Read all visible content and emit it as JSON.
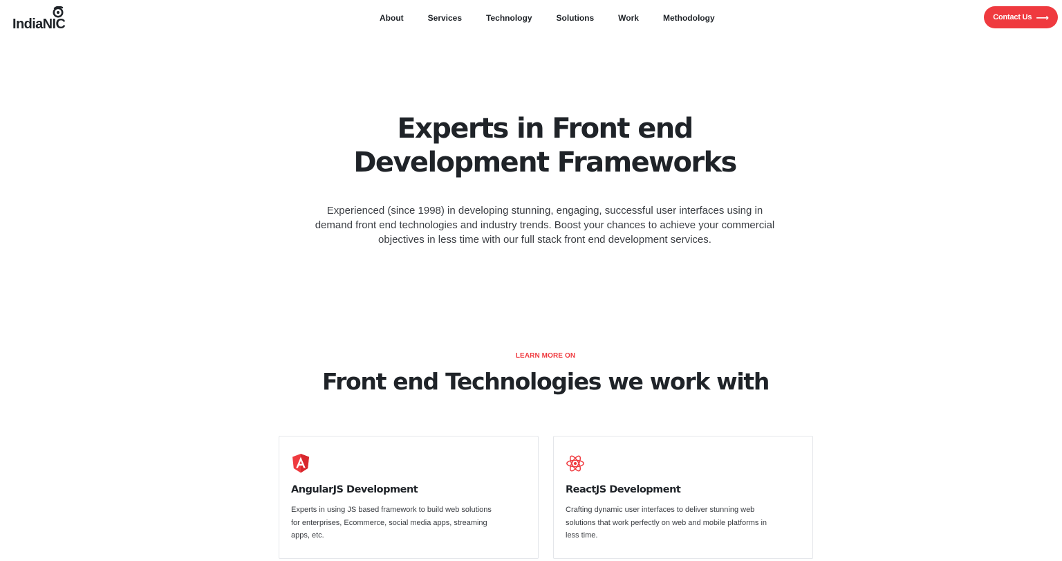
{
  "header": {
    "logo_text": "IndiaNIC",
    "nav": [
      {
        "label": "About"
      },
      {
        "label": "Services"
      },
      {
        "label": "Technology"
      },
      {
        "label": "Solutions"
      },
      {
        "label": "Work"
      },
      {
        "label": "Methodology"
      }
    ],
    "contact_label": "Contact Us",
    "contact_icon": "arrow-right-icon"
  },
  "hero": {
    "title_line1": "Experts in Front end",
    "title_line2": "Development Frameworks",
    "description": "Experienced (since 1998) in developing stunning, engaging, successful user interfaces using in demand front end technologies and industry trends. Boost your chances to achieve your commercial objectives in less time with our full stack front end development services."
  },
  "technologies": {
    "eyebrow": "LEARN MORE ON",
    "title": "Front end Technologies we work with",
    "cards": [
      {
        "icon": "angular-icon",
        "title": "AngularJS Development",
        "description": "Experts in using JS based framework to build web solutions for enterprises, Ecommerce, social media apps, streaming apps, etc."
      },
      {
        "icon": "react-icon",
        "title": "ReactJS Development",
        "description": "Crafting dynamic user interfaces to deliver stunning web solutions that work perfectly on web and mobile platforms in less time."
      }
    ]
  },
  "colors": {
    "accent": "#ef3a3f",
    "text": "#1f2328",
    "body_text": "#3a3d42",
    "card_border": "#e4e6ea"
  }
}
